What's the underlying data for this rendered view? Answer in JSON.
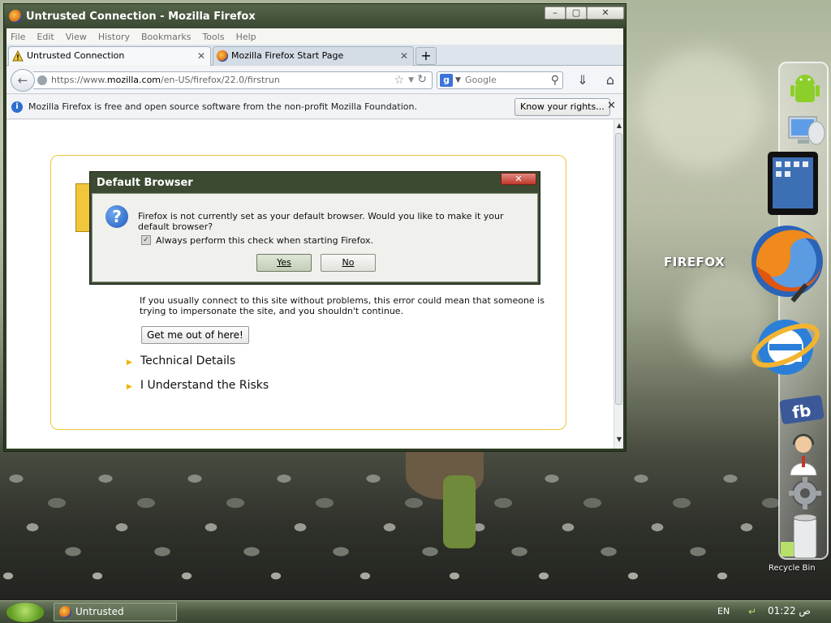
{
  "window": {
    "title": "Untrusted Connection - Mozilla Firefox"
  },
  "menu": [
    "File",
    "Edit",
    "View",
    "History",
    "Bookmarks",
    "Tools",
    "Help"
  ],
  "tabs": [
    {
      "label": "Untrusted Connection",
      "active": true
    },
    {
      "label": "Mozilla Firefox Start Page",
      "active": false
    }
  ],
  "urlbar": {
    "scheme": "https://www.",
    "host": "mozilla.com",
    "path": "/en-US/firefox/22.0/firstrun"
  },
  "search": {
    "engine": "Google",
    "placeholder": "Google"
  },
  "notification": {
    "message": "Mozilla Firefox is free and open source software from the non-profit Mozilla Foundation.",
    "button": "Know your rights..."
  },
  "page": {
    "error_text": "If you usually connect to this site without problems, this error could mean that someone is trying to impersonate the site, and you shouldn't continue.",
    "get_out_button": "Get me out of here!",
    "technical_details": "Technical Details",
    "understand_risks": "I Understand the Risks"
  },
  "dialog": {
    "title": "Default Browser",
    "message": "Firefox is not currently set as your default browser. Would you like to make it your default browser?",
    "checkbox_label": "Always perform this check when starting Firefox.",
    "checkbox_checked": true,
    "yes": "Yes",
    "no": "No"
  },
  "desktop": {
    "firefox_label": "FIREFOX",
    "recycle_bin": "Recycle Bin",
    "dock_icons": [
      "android-icon",
      "computer-icon",
      "tablet-icon",
      "firefox-icon",
      "internet-explorer-icon",
      "facebook-icon",
      "support-agent-icon",
      "settings-icon",
      "recycle-bin-icon"
    ]
  },
  "taskbar": {
    "item": "Untrusted Connecti...",
    "language": "EN",
    "time": "01:22 ص"
  }
}
